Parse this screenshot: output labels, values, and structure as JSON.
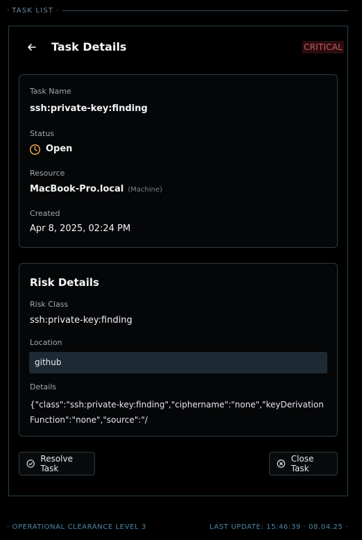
{
  "header": {
    "dot_left": "·",
    "title": "TASK LIST",
    "dot_right": "·"
  },
  "page": {
    "title": "Task Details",
    "severity": "CRITICAL",
    "severity_color": "#c85a5f"
  },
  "task": {
    "name_label": "Task Name",
    "name_value": "ssh:private-key:finding",
    "status_label": "Status",
    "status_value": "Open",
    "status_icon": "clock-icon",
    "status_color": "#e8a44c",
    "resource_label": "Resource",
    "resource_value": "MacBook-Pro.local",
    "resource_type": "(Machine)",
    "created_label": "Created",
    "created_value": "Apr 8, 2025, 02:24 PM"
  },
  "risk": {
    "title": "Risk Details",
    "class_label": "Risk Class",
    "class_value": "ssh:private-key:finding",
    "location_label": "Location",
    "location_value": "github",
    "details_label": "Details",
    "details_value": "{\"class\":\"ssh:private-key:finding\",\"ciphername\":\"none\",\"keyDerivationFunction\":\"none\",\"source\":\"/"
  },
  "actions": {
    "resolve_label": "Resolve Task",
    "close_label": "Close Task"
  },
  "footer": {
    "left": "· OPERATIONAL CLEARANCE LEVEL 3",
    "right": "LAST UPDATE: 15:46:39 · 08.04.25 ·"
  }
}
